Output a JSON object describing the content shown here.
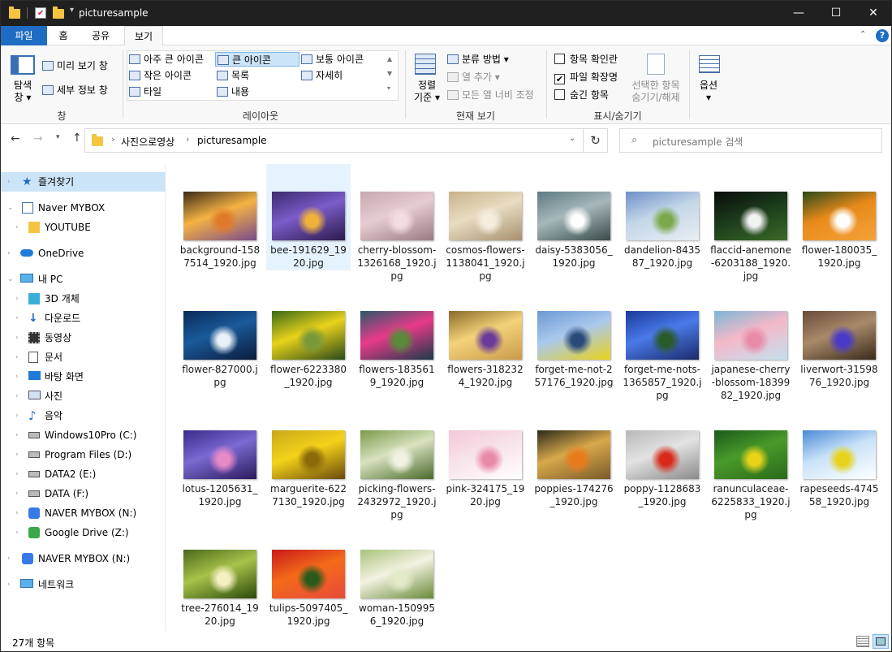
{
  "window": {
    "title": "picturesample",
    "qa_chevron": "▾"
  },
  "menu": {
    "file": "파일",
    "home": "홈",
    "share": "공유",
    "view": "보기"
  },
  "ribbon": {
    "pane": {
      "preview": "미리 보기 창",
      "details": "세부 정보 창",
      "nav_line1": "탐색",
      "nav_line2": "창",
      "group": "창"
    },
    "layout": {
      "xl": "아주 큰 아이콘",
      "large": "큰 아이콘",
      "medium": "보통 아이콘",
      "small": "작은 아이콘",
      "list": "목록",
      "details": "자세히",
      "tiles": "타일",
      "content": "내용",
      "group": "레이아웃"
    },
    "current": {
      "sort_line1": "정렬",
      "sort_line2": "기준",
      "groupby": "분류 방법",
      "addcol": "열 추가",
      "fitcols": "모든 열 너비 조정",
      "group": "현재 보기"
    },
    "showhide": {
      "checkboxes": "항목 확인란",
      "extensions": "파일 확장명",
      "hidden": "숨긴 항목",
      "hide_sel_line1": "선택한 항목",
      "hide_sel_line2": "숨기기/해제",
      "group": "표시/숨기기"
    },
    "options": {
      "label": "옵션"
    }
  },
  "address": {
    "root": "사진으로영상",
    "current": "picturesample",
    "search_placeholder": "picturesample 검색"
  },
  "nav": {
    "quick_access": "즐겨찾기",
    "mybox": "Naver MYBOX",
    "youtube": "YOUTUBE",
    "onedrive": "OneDrive",
    "thispc": "내 PC",
    "objects3d": "3D 개체",
    "downloads": "다운로드",
    "videos": "동영상",
    "documents": "문서",
    "desktop": "바탕 화면",
    "pictures": "사진",
    "music": "음악",
    "c": "Windows10Pro (C:)",
    "d": "Program Files (D:)",
    "e": "DATA2 (E:)",
    "f": "DATA (F:)",
    "n": "NAVER MYBOX (N:)",
    "z": "Google Drive (Z:)",
    "n2": "NAVER MYBOX (N:)",
    "network": "네트워크"
  },
  "files": [
    {
      "name": "background-1587514_1920.jpg",
      "colors": [
        "#3a2a1a",
        "#f5b342",
        "#e07a2a",
        "#7a4a8a"
      ]
    },
    {
      "name": "bee-191629_1920.jpg",
      "colors": [
        "#3a2a6e",
        "#7b5cc9",
        "#f0b23a",
        "#2a1a4a"
      ]
    },
    {
      "name": "cherry-blossom-1326168_1920.jpg",
      "colors": [
        "#c8a8b0",
        "#e6ccd2",
        "#f4dde2",
        "#9a7a82"
      ]
    },
    {
      "name": "cosmos-flowers-1138041_1920.jpg",
      "colors": [
        "#c9b28a",
        "#e8dcc2",
        "#f5eee0",
        "#a89070"
      ]
    },
    {
      "name": "daisy-5383056_1920.jpg",
      "colors": [
        "#5e7a82",
        "#a6b8ba",
        "#ffffff",
        "#3a4a4a"
      ]
    },
    {
      "name": "dandelion-843587_1920.jpg",
      "colors": [
        "#6e8ec8",
        "#c2d6e8",
        "#7aa84a",
        "#e8eef2"
      ]
    },
    {
      "name": "flaccid-anemone-6203188_1920.jpg",
      "colors": [
        "#0a0a0a",
        "#1a3a1a",
        "#f2f2f2",
        "#3a6a2a"
      ]
    },
    {
      "name": "flower-180035_1920.jpg",
      "colors": [
        "#2a4a1a",
        "#e88a1a",
        "#ffffff",
        "#f4a23a"
      ]
    },
    {
      "name": "flower-827000.jpg",
      "colors": [
        "#0a2a5a",
        "#1a5a9a",
        "#e8f0f8",
        "#0a1a3a"
      ]
    },
    {
      "name": "flower-6223380_1920.jpg",
      "colors": [
        "#3a6a1a",
        "#e8d21a",
        "#7a9a3a",
        "#2a4a1a"
      ]
    },
    {
      "name": "flowers-1835619_1920.jpg",
      "colors": [
        "#2a5a6a",
        "#e83a8a",
        "#5a8a3a",
        "#1a3a4a"
      ]
    },
    {
      "name": "flowers-3182324_1920.jpg",
      "colors": [
        "#8a6a2a",
        "#f4d27a",
        "#6a3a9a",
        "#c89a4a"
      ]
    },
    {
      "name": "forget-me-not-257176_1920.jpg",
      "colors": [
        "#6a9ad2",
        "#aac8ee",
        "#2a4a7a",
        "#e8d21a"
      ]
    },
    {
      "name": "forget-me-nots-1365857_1920.jpg",
      "colors": [
        "#1a3a9a",
        "#4a7ae8",
        "#2a5a2a",
        "#1a2a6a"
      ]
    },
    {
      "name": "japanese-cherry-blossom-1839982_1920.jpg",
      "colors": [
        "#7ab8d8",
        "#f4b8c8",
        "#e88aa8",
        "#c2e0ee"
      ]
    },
    {
      "name": "liverwort-3159876_1920.jpg",
      "colors": [
        "#6a4a3a",
        "#a88a6a",
        "#4a3ac8",
        "#3a2a1a"
      ]
    },
    {
      "name": "lotus-1205631_1920.jpg",
      "colors": [
        "#3a2a8a",
        "#7a6ad2",
        "#e88ac8",
        "#2a1a5a"
      ]
    },
    {
      "name": "marguerite-6227130_1920.jpg",
      "colors": [
        "#c8a81a",
        "#f4d21a",
        "#8a6a0a",
        "#6a4a0a"
      ]
    },
    {
      "name": "picking-flowers-2432972_1920.jpg",
      "colors": [
        "#7a9a4a",
        "#d8e2c0",
        "#f2f2e2",
        "#4a6a2a"
      ]
    },
    {
      "name": "pink-324175_1920.jpg",
      "colors": [
        "#f2c8d8",
        "#f8e2ea",
        "#e88aa8",
        "#ffffff"
      ]
    },
    {
      "name": "poppies-174276_1920.jpg",
      "colors": [
        "#2a2a1a",
        "#d8a84a",
        "#e87a1a",
        "#7a5a2a"
      ]
    },
    {
      "name": "poppy-1128683_1920.jpg",
      "colors": [
        "#b8b8b8",
        "#e2e2e2",
        "#d82a1a",
        "#8a8a8a"
      ]
    },
    {
      "name": "ranunculaceae-6225833_1920.jpg",
      "colors": [
        "#1a5a1a",
        "#4a9a2a",
        "#e8d21a",
        "#2a6a1a"
      ]
    },
    {
      "name": "rapeseeds-474558_1920.jpg",
      "colors": [
        "#4a8ad8",
        "#c8e2f8",
        "#e8d21a",
        "#ffffff"
      ]
    },
    {
      "name": "tree-276014_1920.jpg",
      "colors": [
        "#4a6a1a",
        "#a8c24a",
        "#f4f0c2",
        "#2a4a0a"
      ]
    },
    {
      "name": "tulips-5097405_1920.jpg",
      "colors": [
        "#c81a1a",
        "#f46a1a",
        "#2a5a1a",
        "#e84a3a"
      ]
    },
    {
      "name": "woman-1509956_1920.jpg",
      "colors": [
        "#a8c27a",
        "#f4f2e2",
        "#e2eac8",
        "#6a8a3a"
      ]
    }
  ],
  "status": {
    "count": "27개 항목"
  }
}
